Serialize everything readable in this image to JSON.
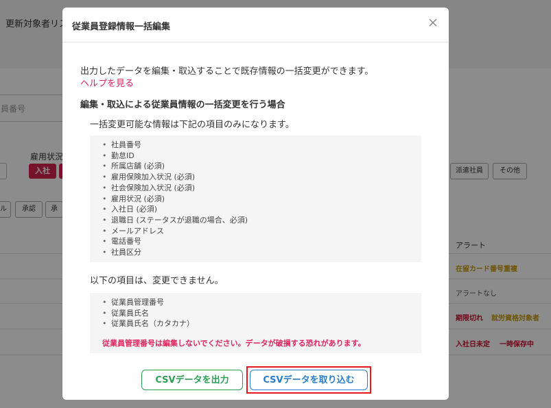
{
  "background": {
    "page_title": "更新対象者リス",
    "search_placeholder": "員番号",
    "employment_status_label": "雇用状況",
    "join_chip": "入社",
    "haken_chip": "派遣社員",
    "other_chip": "その他",
    "chip_l1": "ル",
    "chip_l2": "承認",
    "chip_l3": "承",
    "alert_header": "アラート",
    "row1_alert": "在留カード番号重複",
    "row2_alert": "アラートなし",
    "row3_alert_a": "期限切れ",
    "row3_alert_b": "就労資格対象者",
    "row4_alert_a": "入社日未定",
    "row4_alert_b": "一時保存中"
  },
  "modal": {
    "title": "従業員登録情報一括編集",
    "intro": "出力したデータを編集・取込することで既存情報の一括変更ができます。",
    "help_link": "ヘルプを見る",
    "section_title": "編集・取込による従業員情報の一括変更を行う場合",
    "section_desc": "一括変更可能な情報は下記の項目のみになります。",
    "editable_items": [
      "社員番号",
      "勤怠ID",
      "所属店舗 (必須)",
      "雇用保険加入状況 (必須)",
      "社会保険加入状況 (必須)",
      "雇用状況 (必須)",
      "入社日 (必須)",
      "退職日 (ステータスが退職の場合、必須)",
      "メールアドレス",
      "電話番号",
      "社員区分"
    ],
    "cant_change_desc": "以下の項目は、変更できません。",
    "fixed_items": [
      "従業員管理番号",
      "従業員氏名",
      "従業員氏名（カタカナ）"
    ],
    "warning": "従業員管理番号は編集しないでください。データが破損する恐れがあります。",
    "export_button": "CSVデータを出力",
    "import_button": "CSVデータを取り込む"
  },
  "colors": {
    "accent_pink": "#e0245e",
    "export_green": "#2e9e55",
    "import_blue": "#2a7ec9",
    "highlight_red": "#e8161f"
  }
}
